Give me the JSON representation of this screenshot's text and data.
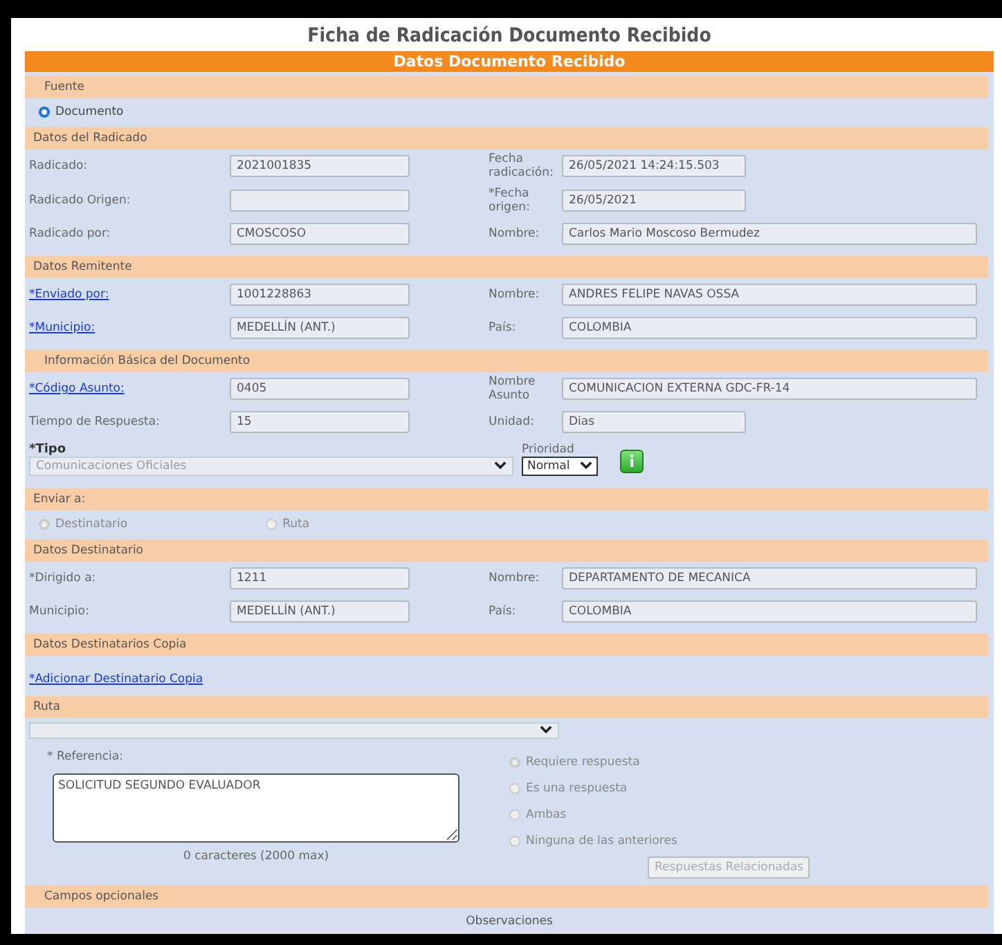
{
  "title": "Ficha de Radicación Documento Recibido",
  "header": "Datos Documento Recibido",
  "rows": [
    {
      "kind": "band",
      "label": "Fuente",
      "indent": true
    },
    {
      "kind": "radios",
      "options": [
        {
          "label": "Documento",
          "selected": true,
          "disabled": false
        }
      ]
    },
    {
      "kind": "band",
      "label": "Datos del Radicado",
      "indent": false
    },
    {
      "kind": "fields",
      "label": "Radicado:",
      "link": false,
      "value": "2021001835",
      "label2": "Fecha radicación:",
      "value2": "26/05/2021 14:24:15.503",
      "wide": false
    },
    {
      "kind": "fields",
      "label": "Radicado Origen:",
      "link": false,
      "label2": "*Fecha origen:",
      "value2": "26/05/2021",
      "wide": false
    },
    {
      "kind": "fields",
      "label": "Radicado por:",
      "link": false,
      "value": "CMOSCOSO",
      "label2": "Nombre:",
      "value2": "Carlos Mario Moscoso Bermudez",
      "wide": true
    },
    {
      "kind": "band",
      "label": "Datos Remitente",
      "indent": false
    },
    {
      "kind": "fields",
      "label": "*Enviado por:",
      "link": true,
      "value": "1001228863",
      "label2": "Nombre:",
      "value2": "ANDRES FELIPE NAVAS OSSA",
      "wide": true
    },
    {
      "kind": "fields",
      "label": "*Municipio:",
      "link": true,
      "value": "MEDELLÍN (ANT.)",
      "label2": "País:",
      "value2": "COLOMBIA",
      "wide": true
    },
    {
      "kind": "band",
      "label": "Información Básica del Documento",
      "indent": true
    },
    {
      "kind": "fields",
      "label": "*Código Asunto:",
      "link": true,
      "value": "0405",
      "label2": "Nombre Asunto",
      "value2": "COMUNICACION EXTERNA GDC-FR-14",
      "wide": true
    },
    {
      "kind": "fields",
      "label": "Tiempo de Respuesta:",
      "link": false,
      "value": "15",
      "label2": "Unidad:",
      "value2": "Dias",
      "wide": false
    },
    {
      "kind": "tipo",
      "label": "*Tipo",
      "select": "Comunicaciones Oficiales",
      "label2": "Prioridad",
      "select2": "Normal"
    },
    {
      "kind": "band",
      "label": "Enviar a:",
      "indent": false
    },
    {
      "kind": "radios",
      "options": [
        {
          "label": "Destinatario",
          "selected": true,
          "disabled": true
        },
        {
          "label": "Ruta",
          "selected": false,
          "disabled": true
        }
      ]
    },
    {
      "kind": "band",
      "label": "Datos Destinatario",
      "indent": false
    },
    {
      "kind": "fields",
      "label": "*Dirigido a:",
      "link": false,
      "value": "1211",
      "label2": "Nombre:",
      "value2": "DEPARTAMENTO DE MECANICA",
      "wide": true
    },
    {
      "kind": "fields",
      "label": "Municipio:",
      "link": false,
      "value": "MEDELLÍN (ANT.)",
      "label2": "País:",
      "value2": "COLOMBIA",
      "wide": true
    },
    {
      "kind": "band",
      "label": "Datos Destinatarios Copia",
      "indent": false
    },
    {
      "kind": "link",
      "label": "*Adicionar Destinatario Copia"
    },
    {
      "kind": "band",
      "label": "Ruta",
      "indent": false
    },
    {
      "kind": "select"
    },
    {
      "kind": "reference",
      "label": "* Referencia:",
      "text": "SOLICITUD SEGUNDO EVALUADOR",
      "counter": "0 caracteres (2000 max)",
      "options": [
        {
          "label": "Requiere respuesta",
          "selected": true,
          "disabled": true
        },
        {
          "label": "Es una respuesta",
          "selected": false,
          "disabled": true
        },
        {
          "label": "Ambas",
          "selected": false,
          "disabled": true
        },
        {
          "label": "Ninguna de las anteriores",
          "selected": false,
          "disabled": true
        }
      ],
      "button": {
        "label": "Respuestas Relacionadas",
        "disabled": true
      }
    },
    {
      "kind": "band",
      "label": "Campos opcionales",
      "indent": true
    },
    {
      "kind": "caption",
      "label": "Observaciones"
    }
  ]
}
